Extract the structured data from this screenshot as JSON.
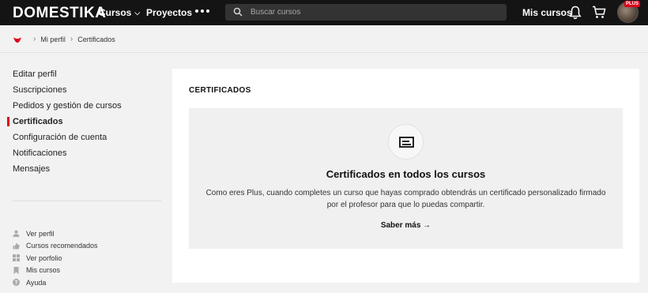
{
  "header": {
    "logo": "DOMESTIKA",
    "nav_cursos": "Cursos",
    "nav_proyectos": "Proyectos",
    "search_placeholder": "Buscar cursos",
    "mis_cursos": "Mis cursos",
    "plus_badge": "PLUS"
  },
  "breadcrumb": {
    "items": [
      "Mi perfil",
      "Certificados"
    ]
  },
  "sidebar": {
    "items": [
      {
        "label": "Editar perfil",
        "active": false
      },
      {
        "label": "Suscripciones",
        "active": false
      },
      {
        "label": "Pedidos y gestión de cursos",
        "active": false
      },
      {
        "label": "Certificados",
        "active": true
      },
      {
        "label": "Configuración de cuenta",
        "active": false
      },
      {
        "label": "Notificaciones",
        "active": false
      },
      {
        "label": "Mensajes",
        "active": false
      }
    ],
    "links": [
      {
        "label": "Ver perfil",
        "icon": "user-icon"
      },
      {
        "label": "Cursos recomendados",
        "icon": "thumbs-up-icon"
      },
      {
        "label": "Ver porfolio",
        "icon": "grid-icon"
      },
      {
        "label": "Mis cursos",
        "icon": "bookmark-icon"
      },
      {
        "label": "Ayuda",
        "icon": "help-icon"
      }
    ]
  },
  "main": {
    "title": "CERTIFICADOS",
    "heading": "Certificados en todos los cursos",
    "description": "Como eres Plus, cuando completes un curso que hayas comprado obtendrás un certificado personalizado firmado por el profesor para que lo puedas compartir.",
    "link": "Saber más →"
  },
  "colors": {
    "accent": "#e0001b",
    "topbar": "#141414",
    "background": "#f2f2f2"
  }
}
